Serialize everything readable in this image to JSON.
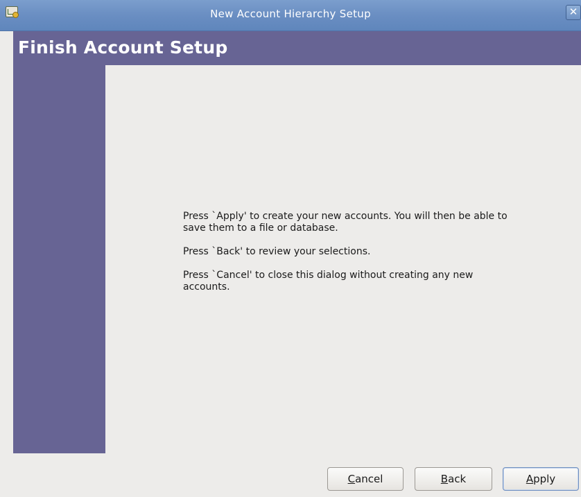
{
  "window": {
    "title": "New Account Hierarchy Setup",
    "close_glyph": "✕"
  },
  "page": {
    "title": "Finish Account Setup"
  },
  "message": {
    "paragraphs": [
      "Press `Apply' to create your new accounts.  You will then be able to save them to a file or database.",
      "Press `Back' to review your selections.",
      "Press `Cancel' to close this dialog without creating any new accounts."
    ]
  },
  "buttons": {
    "cancel": {
      "mnemonic": "C",
      "rest": "ancel"
    },
    "back": {
      "mnemonic": "B",
      "rest": "ack"
    },
    "apply": {
      "mnemonic": "A",
      "rest": "pply"
    }
  },
  "colors": {
    "titlebar": "#6a8ec2",
    "band": "#676494",
    "content": "#edecea"
  },
  "icons": {
    "app": "gnucash-app-icon",
    "close": "close-icon"
  }
}
